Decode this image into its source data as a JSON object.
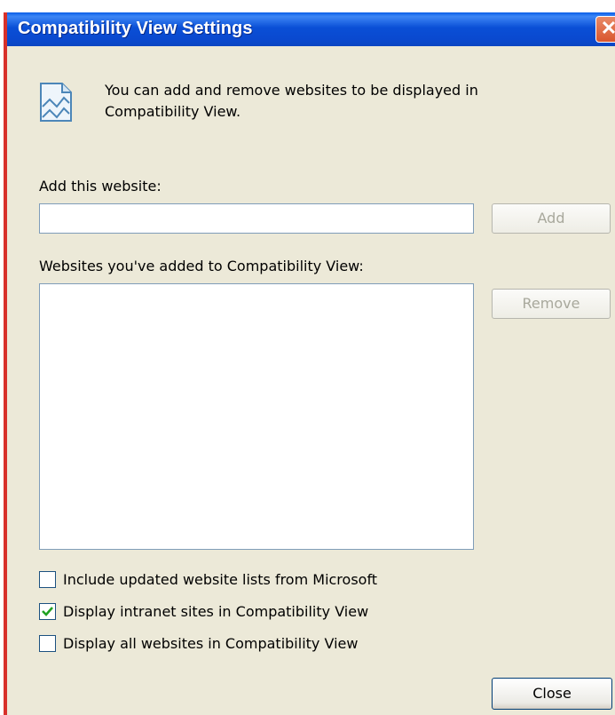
{
  "dialog": {
    "title": "Compatibility View Settings",
    "close_glyph": "✕",
    "info_text": "You can add and remove websites to be displayed in Compatibility View."
  },
  "add_section": {
    "label": "Add this website:",
    "input_value": "",
    "add_button": "Add"
  },
  "list_section": {
    "label": "Websites you've added to Compatibility View:",
    "items": [],
    "remove_button": "Remove"
  },
  "options": [
    {
      "label": "Include updated website lists from Microsoft",
      "checked": false
    },
    {
      "label": "Display intranet sites in Compatibility View",
      "checked": true
    },
    {
      "label": "Display all websites in Compatibility View",
      "checked": false
    }
  ],
  "footer": {
    "close_button": "Close"
  },
  "colors": {
    "titlebar": "#0a4fd6",
    "dialog_bg": "#ece9d8",
    "checkmark": "#21a121"
  }
}
